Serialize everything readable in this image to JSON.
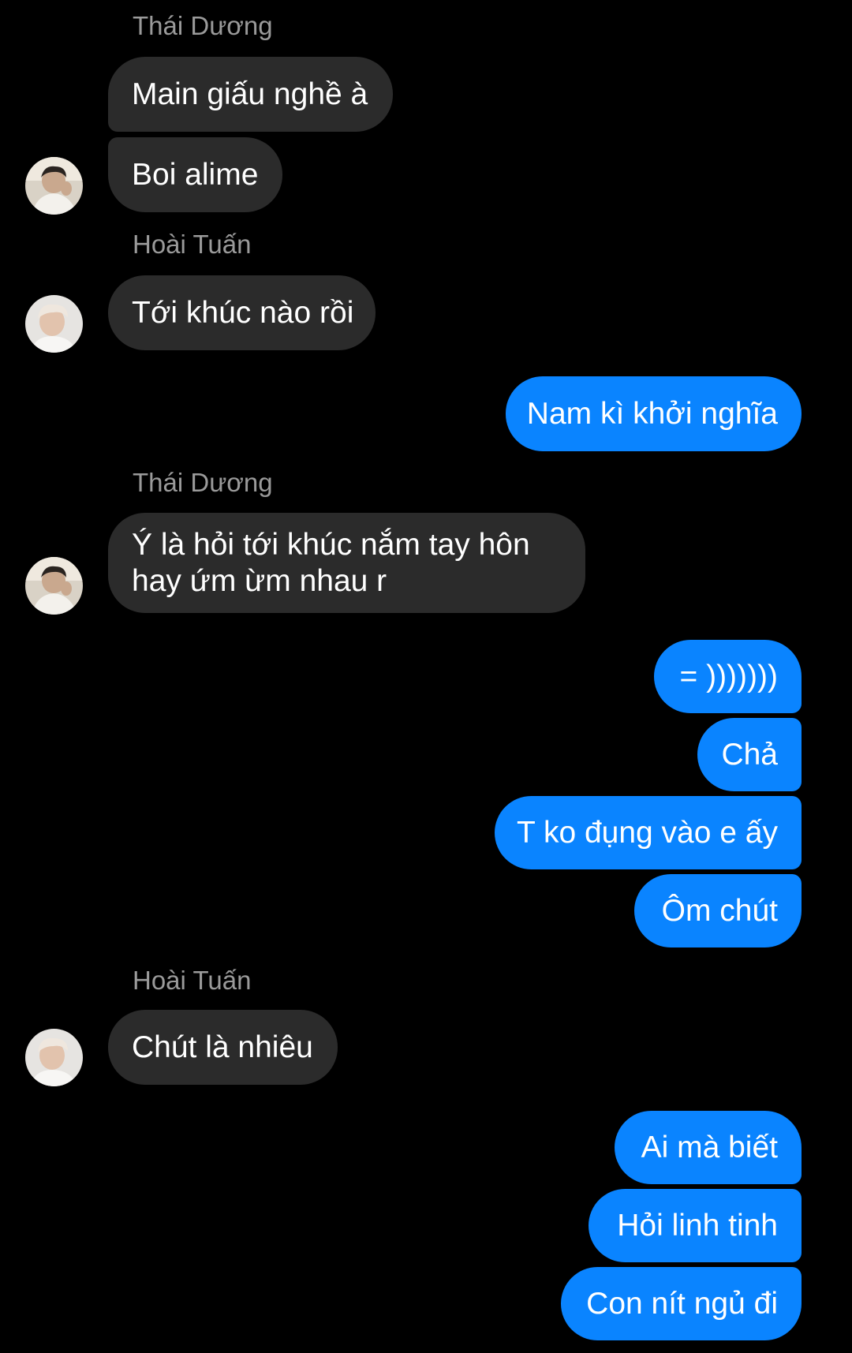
{
  "colors": {
    "background": "#000000",
    "incoming_bubble": "#2b2b2b",
    "outgoing_bubble": "#0a84ff",
    "sender_name": "#9a9a9a"
  },
  "messages": [
    {
      "type": "sender",
      "text": "Thái Dương"
    },
    {
      "type": "incoming",
      "text": "Main giấu nghề à"
    },
    {
      "type": "incoming",
      "text": "Boi alime",
      "avatar": "avatar-thai-duong"
    },
    {
      "type": "sender",
      "text": "Hoài Tuấn"
    },
    {
      "type": "incoming",
      "text": "Tới khúc nào rồi",
      "avatar": "avatar-hoai-tuan"
    },
    {
      "type": "outgoing",
      "text": "Nam kì khởi nghĩa"
    },
    {
      "type": "sender",
      "text": "Thái Dương"
    },
    {
      "type": "incoming",
      "text": "Ý là hỏi tới khúc nắm tay hôn hay ứm ừm nhau r",
      "avatar": "avatar-thai-duong"
    },
    {
      "type": "outgoing",
      "text": "= )))))))"
    },
    {
      "type": "outgoing",
      "text": "Chả"
    },
    {
      "type": "outgoing",
      "text": "T ko đụng vào e ấy"
    },
    {
      "type": "outgoing",
      "text": "Ôm chút"
    },
    {
      "type": "sender",
      "text": "Hoài Tuấn"
    },
    {
      "type": "incoming",
      "text": "Chút là nhiêu",
      "avatar": "avatar-hoai-tuan"
    },
    {
      "type": "outgoing",
      "text": "Ai mà biết"
    },
    {
      "type": "outgoing",
      "text": "Hỏi linh tinh"
    },
    {
      "type": "outgoing",
      "text": "Con nít ngủ đi"
    }
  ]
}
